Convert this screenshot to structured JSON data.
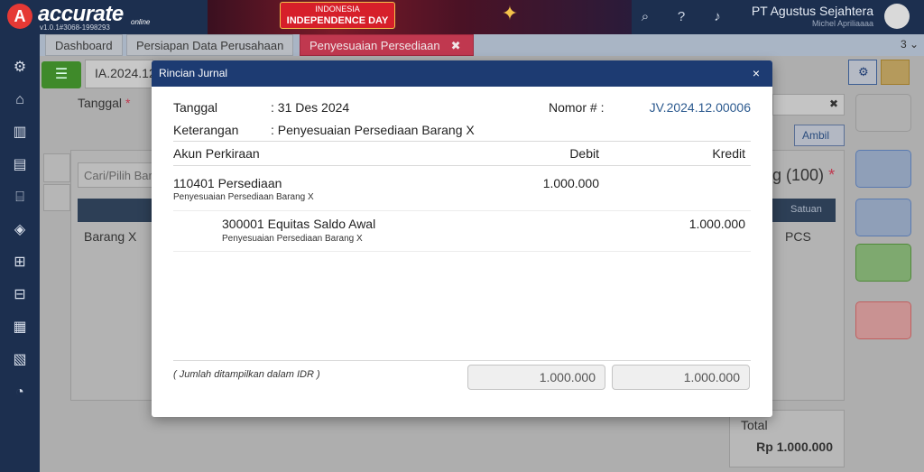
{
  "app": {
    "logo_letter": "A",
    "logo_text": "accurate",
    "logo_sub": "online",
    "version": "v1.0.1#3068-1998293",
    "banner_line1": "INDONESIA",
    "banner_line2": "INDEPENDENCE DAY",
    "company": "PT Agustus Sejahtera",
    "user": "Michel Apriliaaaa"
  },
  "tabs": [
    {
      "label": "Dashboard"
    },
    {
      "label": "Persiapan Data Perusahaan"
    },
    {
      "label": "Penyesuaian Persediaan",
      "close": "✖"
    }
  ],
  "tab_count": "3 ⌄",
  "background": {
    "doc_number": "IA.2024.12",
    "tanggal_label": "Tanggal",
    "required_mark": "*",
    "search_placeholder": "Cari/Pilih Bar",
    "ambil_label": "Ambil",
    "item_name": "Barang X",
    "qty_header": "g (100)",
    "satuan_header": "Satuan",
    "satuan_value": "PCS",
    "total_label": "Total",
    "total_value": "Rp 1.000.000"
  },
  "modal": {
    "title": "Rincian Jurnal",
    "close": "×",
    "tanggal_label": "Tanggal",
    "tanggal_value": ": 31 Des 2024",
    "keterangan_label": "Keterangan",
    "keterangan_value": ": Penyesuaian Persediaan Barang X",
    "nomor_label": "Nomor # :",
    "nomor_value": "JV.2024.12.00006",
    "col_akun": "Akun Perkiraan",
    "col_debit": "Debit",
    "col_kredit": "Kredit",
    "rows": [
      {
        "account": "110401 Persediaan",
        "note": "Penyesuaian Persediaan Barang X",
        "debit": "1.000.000",
        "kredit": ""
      },
      {
        "account": "300001 Equitas Saldo Awal",
        "note": "Penyesuaian Persediaan Barang X",
        "debit": "",
        "kredit": "1.000.000"
      }
    ],
    "footnote": "( Jumlah ditampilkan dalam IDR )",
    "total_debit": "1.000.000",
    "total_kredit": "1.000.000"
  },
  "colors": {
    "topbar": "#1c2f4f",
    "modal_header": "#1d3b72",
    "active_tab": "#c0384f",
    "link_blue": "#2c5a8f"
  }
}
